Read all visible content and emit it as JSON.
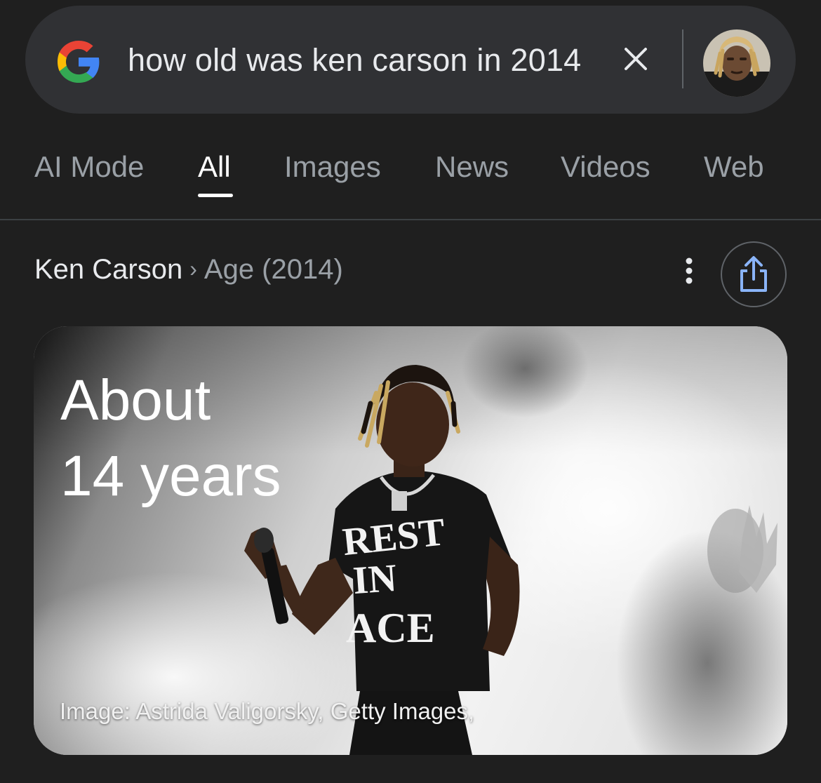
{
  "search": {
    "query": "how old was ken carson in 2014"
  },
  "tabs": [
    {
      "label": "AI Mode",
      "active": false
    },
    {
      "label": "All",
      "active": true
    },
    {
      "label": "Images",
      "active": false
    },
    {
      "label": "News",
      "active": false
    },
    {
      "label": "Videos",
      "active": false
    },
    {
      "label": "Web",
      "active": false
    }
  ],
  "breadcrumb": {
    "entity": "Ken Carson",
    "separator": "›",
    "attribute": "Age (2014)"
  },
  "answer": {
    "line1": "About",
    "line2": "14 years",
    "image_credit": "Image: Astrida Valigorsky, Getty Images,"
  },
  "photo": {
    "shirt_line1": "REST",
    "shirt_line2": "IN",
    "shirt_line3": "ACE"
  },
  "icons": {
    "logo": "google-g-icon",
    "clear": "close-icon",
    "more": "more-vert-icon",
    "share": "share-icon"
  },
  "colors": {
    "background": "#1f1f1f",
    "search_bar": "#303134",
    "active_tab": "#ffffff",
    "inactive_tab": "#9aa0a6",
    "google_blue": "#4285F4",
    "google_red": "#EA4335",
    "google_yellow": "#FBBC05",
    "google_green": "#34A853",
    "share_icon": "#8ab4f8"
  }
}
